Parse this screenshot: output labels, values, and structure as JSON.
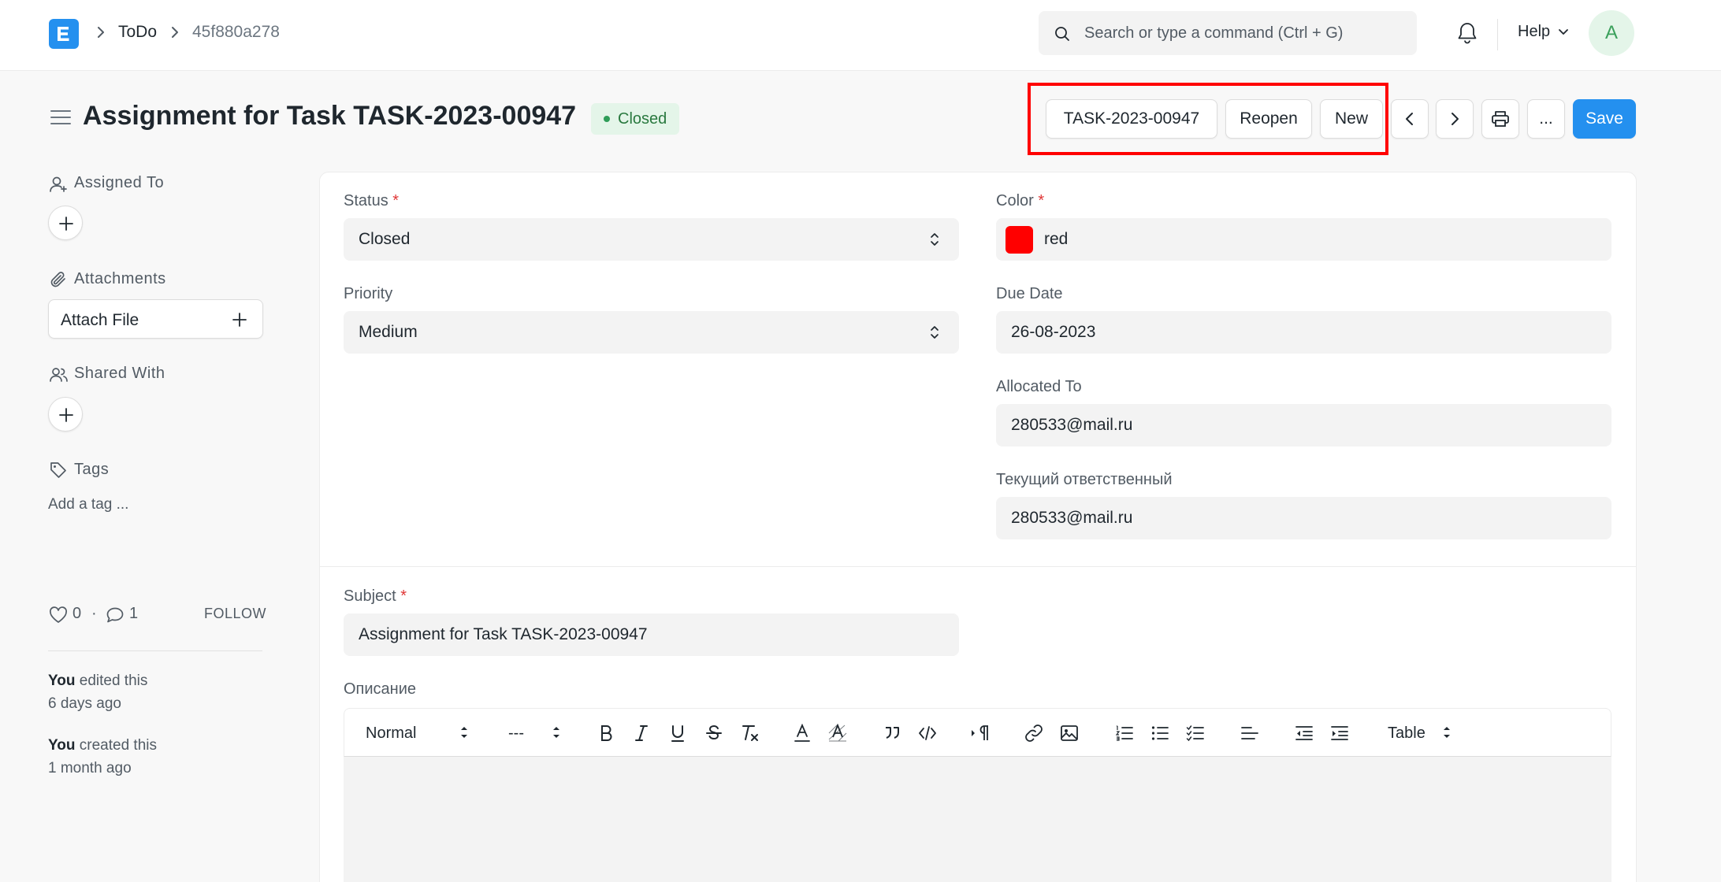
{
  "navbar": {
    "logo_letter": "E",
    "breadcrumbs": [
      "ToDo",
      "45f880a278"
    ],
    "search_placeholder": "Search or type a command (Ctrl + G)",
    "help_label": "Help",
    "avatar_initial": "A"
  },
  "page": {
    "title": "Assignment for Task TASK-2023-00947",
    "status_badge": "Closed",
    "status_color": "#2f9d58"
  },
  "actions": {
    "reference_button": "TASK-2023-00947",
    "reopen_button": "Reopen",
    "new_button": "New",
    "more_button": "...",
    "save_button": "Save",
    "save_color": "#2490ef",
    "highlight_color": "#ff0000"
  },
  "sidebar": {
    "assigned_to": "Assigned To",
    "attachments": "Attachments",
    "attach_file": "Attach File",
    "shared_with": "Shared With",
    "tags": "Tags",
    "add_tag": "Add a tag ...",
    "likes": "0",
    "separator": "·",
    "comments": "1",
    "follow": "FOLLOW",
    "activity": [
      {
        "actor": "You",
        "action": " edited this",
        "time": "6 days ago"
      },
      {
        "actor": "You",
        "action": " created this",
        "time": "1 month ago"
      }
    ]
  },
  "form": {
    "status": {
      "label": "Status",
      "required": "*",
      "value": "Closed"
    },
    "priority": {
      "label": "Priority",
      "value": "Medium"
    },
    "color": {
      "label": "Color",
      "required": "*",
      "value": "red",
      "swatch": "#ff0000"
    },
    "due_date": {
      "label": "Due Date",
      "value": "26-08-2023"
    },
    "allocated_to": {
      "label": "Allocated To",
      "value": "280533@mail.ru"
    },
    "current_responsible": {
      "label": "Текущий ответственный",
      "value": "280533@mail.ru"
    },
    "subject": {
      "label": "Subject",
      "required": "*",
      "value": "Assignment for Task TASK-2023-00947"
    },
    "description": {
      "label": "Описание"
    }
  },
  "editor_toolbar": {
    "paragraph_style": "Normal",
    "font_size": "---",
    "table": "Table"
  }
}
